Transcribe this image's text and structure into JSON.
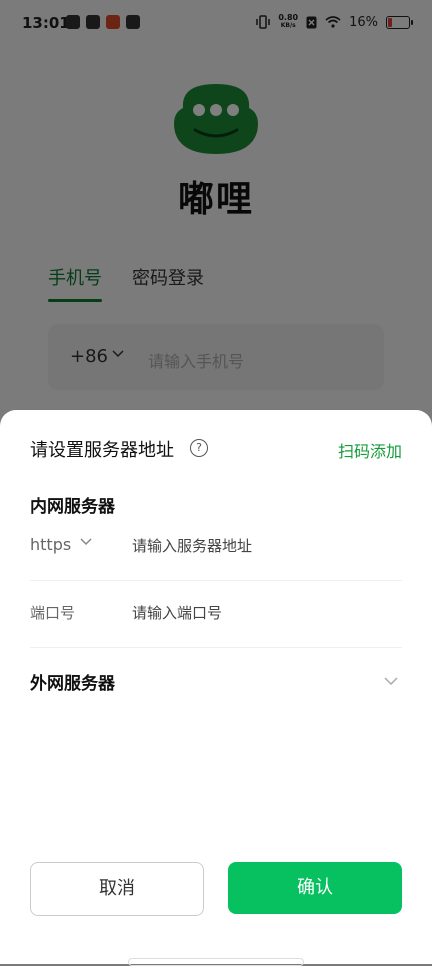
{
  "status_bar": {
    "time": "13:01",
    "net_speed_value": "0.80",
    "net_speed_unit": "KB/s",
    "battery": "16%",
    "battery_level": 0.16,
    "battery_color": "#e23c3c"
  },
  "app": {
    "name": "嘟哩",
    "logo_color": "#1c8a37"
  },
  "login_tabs": {
    "phone": "手机号",
    "password": "密码登录"
  },
  "phone_login": {
    "country_code": "+86",
    "placeholder": "请输入手机号"
  },
  "dialog": {
    "title": "请设置服务器地址",
    "help_symbol": "?",
    "scan_add": "扫码添加",
    "intranet_section": "内网服务器",
    "protocol": "https",
    "address_placeholder": "请输入服务器地址",
    "port_label": "端口号",
    "port_placeholder": "请输入端口号",
    "extranet_section": "外网服务器",
    "cancel": "取消",
    "confirm": "确认",
    "accent_color": "#07c160"
  }
}
